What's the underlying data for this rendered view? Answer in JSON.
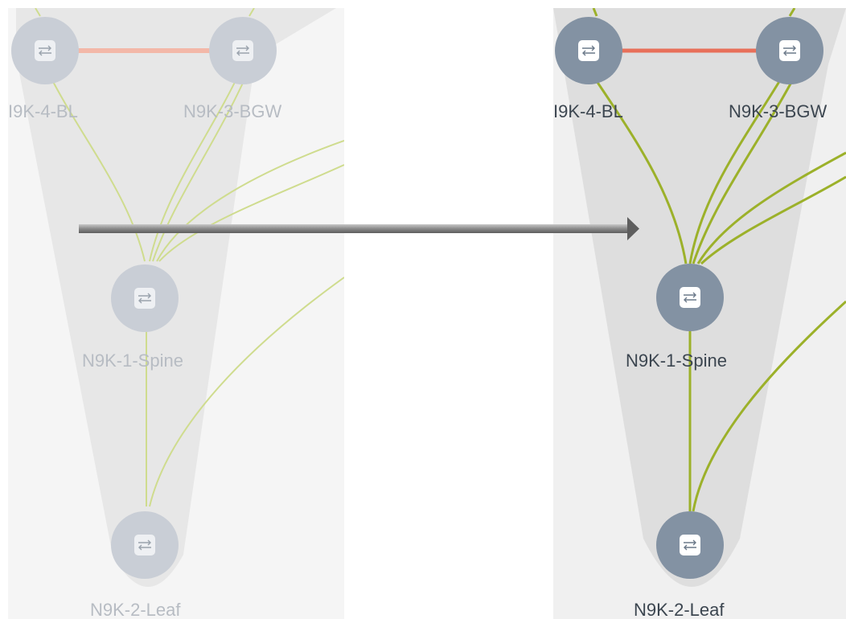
{
  "before": {
    "nodes": [
      {
        "id": "bl",
        "label": "I9K-4-BL"
      },
      {
        "id": "bgw",
        "label": "N9K-3-BGW"
      },
      {
        "id": "spine",
        "label": "N9K-1-Spine"
      },
      {
        "id": "leaf",
        "label": "N9K-2-Leaf"
      }
    ]
  },
  "after": {
    "nodes": [
      {
        "id": "bl",
        "label": "I9K-4-BL"
      },
      {
        "id": "bgw",
        "label": "N9K-3-BGW"
      },
      {
        "id": "spine",
        "label": "N9K-1-Spine"
      },
      {
        "id": "leaf",
        "label": "N9K-2-Leaf"
      }
    ]
  },
  "colors": {
    "link": "#9cb12a",
    "peer_link": "#e8705a",
    "group_fill": "#e4e4e4",
    "node_faded": "#c9ced6",
    "node_active": "#8392a3"
  },
  "icons": {
    "node": "switch-icon",
    "transition": "arrow-right-icon"
  }
}
